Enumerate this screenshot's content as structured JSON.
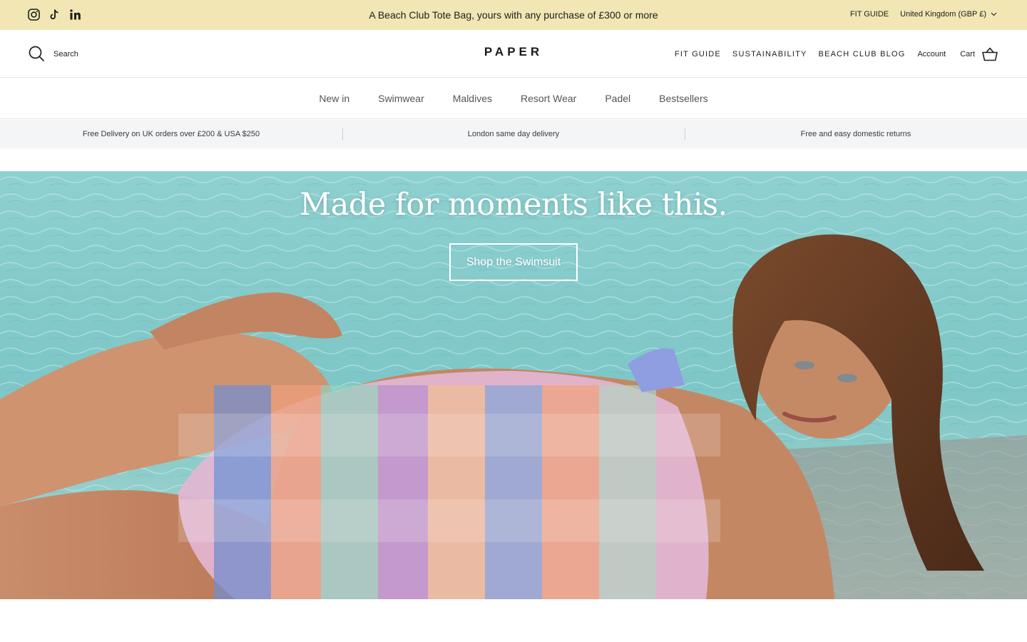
{
  "announcement": {
    "social": [
      "instagram-icon",
      "tiktok-icon",
      "linkedin-icon"
    ],
    "text": "A Beach Club Tote Bag, yours with any purchase of £300 or more",
    "fit_guide": "FIT GUIDE",
    "currency": "United Kingdom (GBP £)",
    "background": "#f1e6b4"
  },
  "header": {
    "search_label": "Search",
    "logo": "PAPER",
    "nav": {
      "fit_guide": "FIT GUIDE",
      "sustainability": "SUSTAINABILITY",
      "blog": "BEACH CLUB BLOG",
      "account": "Account",
      "cart": "Cart"
    }
  },
  "main_nav": {
    "items": [
      "New in",
      "Swimwear",
      "Maldives",
      "Resort Wear",
      "Padel",
      "Bestsellers"
    ]
  },
  "usp": {
    "items": [
      "Free Delivery on UK orders over £200 & USA $250",
      "London same day delivery",
      "Free and easy domestic returns"
    ]
  },
  "hero": {
    "title": "Made for moments like this.",
    "button": "Shop the Swimsuit",
    "water_color": "#7fc9c9"
  }
}
